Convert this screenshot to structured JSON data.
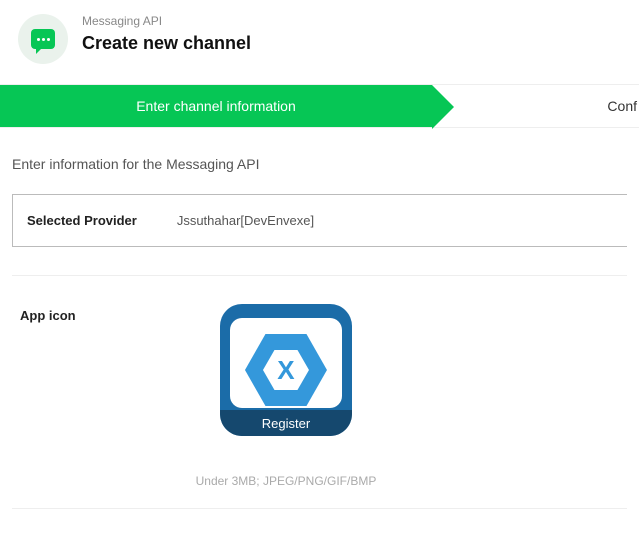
{
  "header": {
    "category": "Messaging API",
    "title": "Create new channel"
  },
  "stepper": {
    "active": "Enter channel information",
    "next_partial": "Conf"
  },
  "description": "Enter information for the Messaging API",
  "provider": {
    "label": "Selected Provider",
    "value": "Jssuthahar[DevEnvexe]"
  },
  "app_icon": {
    "label": "App icon",
    "badge": "Register",
    "glyph": "X",
    "hint": "Under 3MB; JPEG/PNG/GIF/BMP"
  }
}
